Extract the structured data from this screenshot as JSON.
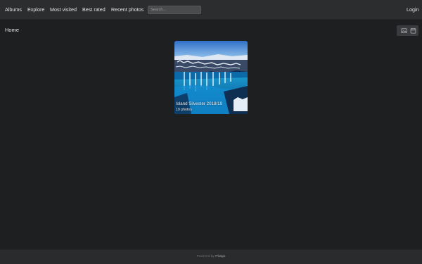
{
  "nav": {
    "items": [
      {
        "label": "Albums"
      },
      {
        "label": "Explore"
      },
      {
        "label": "Most visited"
      },
      {
        "label": "Best rated"
      },
      {
        "label": "Recent photos"
      }
    ],
    "search_placeholder": "Search...",
    "login_label": "Login"
  },
  "breadcrumb": {
    "label": "Home"
  },
  "view_toggle": {
    "icons": [
      "image-icon",
      "calendar-icon"
    ]
  },
  "albums": [
    {
      "title": "Island Silvester 2018/19",
      "count": "19 photos"
    }
  ],
  "footer": {
    "prefix": "Powered by",
    "brand": "Piwigo"
  },
  "colors": {
    "background": "#1e1f21",
    "navbar": "#2c2d2f",
    "footer": "#2a2b2d"
  }
}
